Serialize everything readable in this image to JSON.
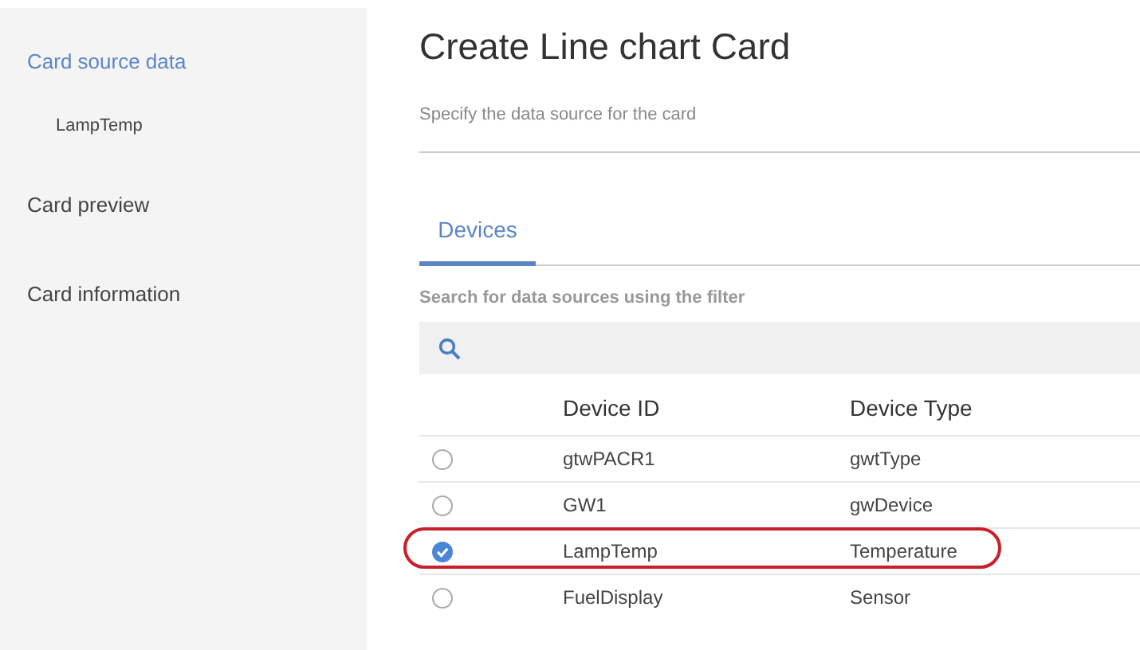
{
  "sidebar": {
    "items": [
      {
        "label": "Card source data",
        "selected": true,
        "children": [
          {
            "label": "LampTemp",
            "selected": false
          }
        ]
      },
      {
        "label": "Card preview",
        "selected": false
      },
      {
        "label": "Card information",
        "selected": false
      }
    ]
  },
  "title": "Create Line chart Card",
  "subtitle": "Specify the data source for the card",
  "tabs": [
    {
      "label": "Devices",
      "selected": true
    }
  ],
  "search": {
    "label": "Search for data sources using the filter"
  },
  "table": {
    "columns": [
      "Device ID",
      "Device Type"
    ],
    "rows": [
      {
        "cells": [
          "gtwPACR1",
          "gwtType"
        ],
        "selected": false,
        "circled": false
      },
      {
        "cells": [
          "GW1",
          "gwDevice"
        ],
        "selected": false,
        "circled": false
      },
      {
        "cells": [
          "LampTemp",
          "Temperature"
        ],
        "selected": true,
        "circled": true
      },
      {
        "cells": [
          "FuelDisplay",
          "Sensor"
        ],
        "selected": false,
        "circled": false
      }
    ]
  }
}
